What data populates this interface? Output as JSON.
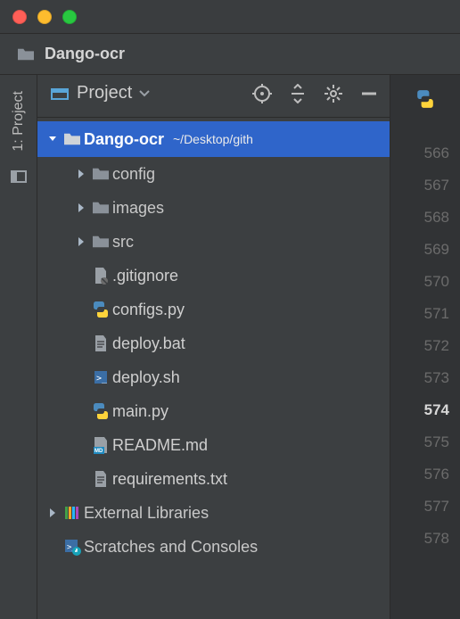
{
  "title_bar": {
    "traffic_lights": [
      "close",
      "minimize",
      "zoom"
    ]
  },
  "breadcrumb": {
    "icon": "folder-icon",
    "label": "Dango-ocr"
  },
  "sidebar_tab": {
    "label": "1: Project",
    "icon": "panel-icon"
  },
  "project_panel": {
    "title_label": "Project",
    "title_icon": "project-module-icon",
    "dropdown_icon": "chevron-down-icon",
    "toolbar_icons": [
      "locate-file-icon",
      "collapse-expand-icon",
      "settings-icon",
      "hide-icon"
    ]
  },
  "tree": {
    "root": {
      "name": "Dango-ocr",
      "path_suffix": "~/Desktop/gith",
      "expanded": true,
      "selected": true
    },
    "folders": [
      {
        "name": "config",
        "expanded": false
      },
      {
        "name": "images",
        "expanded": false
      },
      {
        "name": "src",
        "expanded": false
      }
    ],
    "files": [
      {
        "name": ".gitignore",
        "icon": "file-ignore-icon"
      },
      {
        "name": "configs.py",
        "icon": "python-file-icon"
      },
      {
        "name": "deploy.bat",
        "icon": "text-file-icon"
      },
      {
        "name": "deploy.sh",
        "icon": "shell-file-icon"
      },
      {
        "name": "main.py",
        "icon": "python-file-icon"
      },
      {
        "name": "README.md",
        "icon": "markdown-file-icon"
      },
      {
        "name": "requirements.txt",
        "icon": "text-file-icon"
      }
    ],
    "extras": [
      {
        "name": "External Libraries",
        "icon": "libraries-icon",
        "has_arrow": true
      },
      {
        "name": "Scratches and Consoles",
        "icon": "scratches-icon",
        "has_arrow": false
      }
    ]
  },
  "editor": {
    "tab_icon": "python-file-icon",
    "line_numbers": [
      "566",
      "567",
      "568",
      "569",
      "570",
      "571",
      "572",
      "573",
      "574",
      "575",
      "576",
      "577",
      "578"
    ],
    "current_line": "574"
  },
  "colors": {
    "selection": "#2f65ca",
    "bg": "#3c3f41",
    "gutter": "#313335"
  }
}
